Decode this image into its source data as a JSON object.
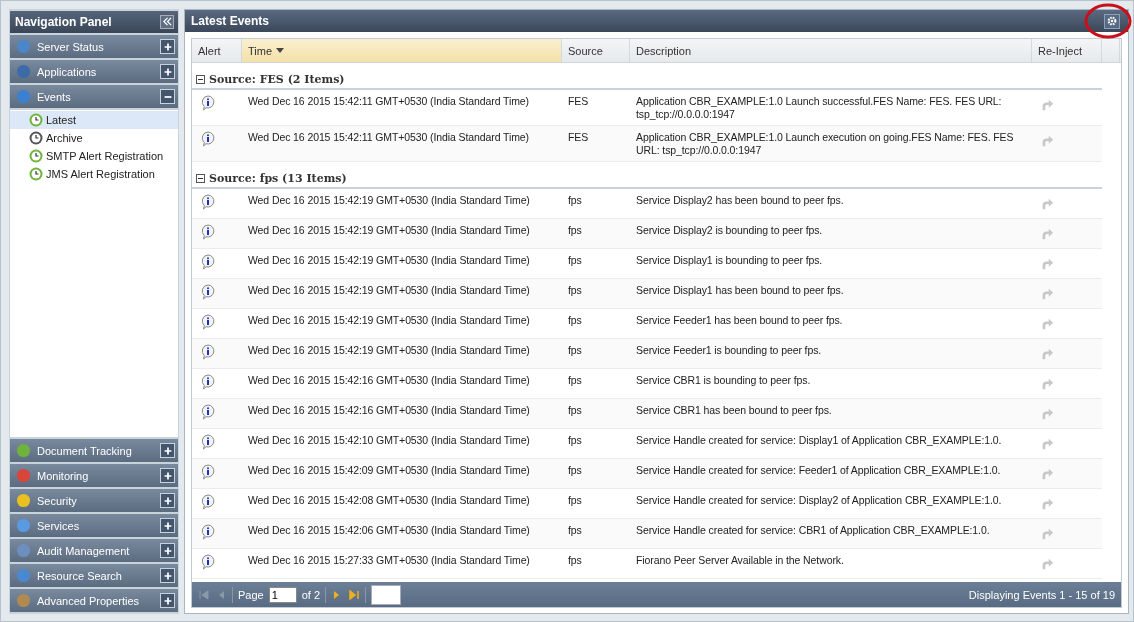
{
  "nav": {
    "title": "Navigation Panel",
    "sections": [
      {
        "label": "Server Status",
        "expanded": false
      },
      {
        "label": "Applications",
        "expanded": false
      },
      {
        "label": "Events",
        "expanded": true,
        "children": [
          {
            "label": "Latest",
            "selected": true,
            "color": "#6fb33c"
          },
          {
            "label": "Archive",
            "selected": false,
            "color": "#555555"
          },
          {
            "label": "SMTP Alert Registration",
            "selected": false,
            "color": "#6fb33c"
          },
          {
            "label": "JMS Alert Registration",
            "selected": false,
            "color": "#6fb33c"
          }
        ]
      },
      {
        "label": "Document Tracking",
        "expanded": false
      },
      {
        "label": "Monitoring",
        "expanded": false
      },
      {
        "label": "Security",
        "expanded": false
      },
      {
        "label": "Services",
        "expanded": false
      },
      {
        "label": "Audit Management",
        "expanded": false
      },
      {
        "label": "Resource Search",
        "expanded": false
      },
      {
        "label": "Advanced Properties",
        "expanded": false
      }
    ]
  },
  "panel": {
    "title": "Latest Events"
  },
  "table": {
    "columns": [
      {
        "label": "Alert",
        "sorted": false
      },
      {
        "label": "Time",
        "sorted": true
      },
      {
        "label": "Source",
        "sorted": false
      },
      {
        "label": "Description",
        "sorted": false
      },
      {
        "label": "Re-Inject",
        "sorted": false
      }
    ],
    "groups": [
      {
        "title": "Source: FES (2 Items)",
        "expanded": true,
        "rows": [
          {
            "time": "Wed Dec 16 2015 15:42:11 GMT+0530 (India Standard Time)",
            "source": "FES",
            "description": "Application CBR_EXAMPLE:1.0 Launch successful.FES Name: FES. FES URL: tsp_tcp://0.0.0.0:1947"
          },
          {
            "time": "Wed Dec 16 2015 15:42:11 GMT+0530 (India Standard Time)",
            "source": "FES",
            "description": "Application CBR_EXAMPLE:1.0 Launch execution on going.FES Name: FES. FES URL: tsp_tcp://0.0.0.0:1947"
          }
        ]
      },
      {
        "title": "Source: fps (13 Items)",
        "expanded": true,
        "rows": [
          {
            "time": "Wed Dec 16 2015 15:42:19 GMT+0530 (India Standard Time)",
            "source": "fps",
            "description": "Service Display2 has been bound to peer fps."
          },
          {
            "time": "Wed Dec 16 2015 15:42:19 GMT+0530 (India Standard Time)",
            "source": "fps",
            "description": "Service Display2 is bounding to peer fps."
          },
          {
            "time": "Wed Dec 16 2015 15:42:19 GMT+0530 (India Standard Time)",
            "source": "fps",
            "description": "Service Display1 is bounding to peer fps."
          },
          {
            "time": "Wed Dec 16 2015 15:42:19 GMT+0530 (India Standard Time)",
            "source": "fps",
            "description": "Service Display1 has been bound to peer fps."
          },
          {
            "time": "Wed Dec 16 2015 15:42:19 GMT+0530 (India Standard Time)",
            "source": "fps",
            "description": "Service Feeder1 has been bound to peer fps."
          },
          {
            "time": "Wed Dec 16 2015 15:42:19 GMT+0530 (India Standard Time)",
            "source": "fps",
            "description": "Service Feeder1 is bounding to peer fps."
          },
          {
            "time": "Wed Dec 16 2015 15:42:16 GMT+0530 (India Standard Time)",
            "source": "fps",
            "description": "Service CBR1 is bounding to peer fps."
          },
          {
            "time": "Wed Dec 16 2015 15:42:16 GMT+0530 (India Standard Time)",
            "source": "fps",
            "description": "Service CBR1 has been bound to peer fps."
          },
          {
            "time": "Wed Dec 16 2015 15:42:10 GMT+0530 (India Standard Time)",
            "source": "fps",
            "description": "Service Handle created for service: Display1 of Application CBR_EXAMPLE:1.0."
          },
          {
            "time": "Wed Dec 16 2015 15:42:09 GMT+0530 (India Standard Time)",
            "source": "fps",
            "description": "Service Handle created for service: Feeder1 of Application CBR_EXAMPLE:1.0."
          },
          {
            "time": "Wed Dec 16 2015 15:42:08 GMT+0530 (India Standard Time)",
            "source": "fps",
            "description": "Service Handle created for service: Display2 of Application CBR_EXAMPLE:1.0."
          },
          {
            "time": "Wed Dec 16 2015 15:42:06 GMT+0530 (India Standard Time)",
            "source": "fps",
            "description": "Service Handle created for service: CBR1 of Application CBR_EXAMPLE:1.0."
          },
          {
            "time": "Wed Dec 16 2015 15:27:33 GMT+0530 (India Standard Time)",
            "source": "fps",
            "description": "Fiorano Peer Server Available in the Network."
          }
        ]
      }
    ]
  },
  "pager": {
    "page_label": "Page",
    "page": "1",
    "of_label": "of 2",
    "status": "Displaying Events 1 - 15 of 19"
  }
}
